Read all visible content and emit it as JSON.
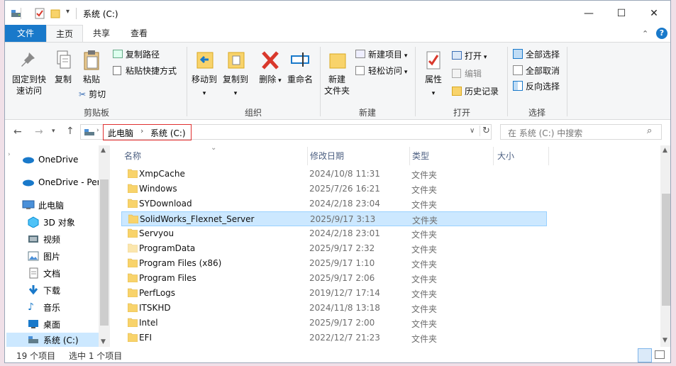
{
  "window": {
    "title": "系统 (C:)"
  },
  "ribbon_tabs": [
    "文件",
    "主页",
    "共享",
    "查看"
  ],
  "clipboard": {
    "pin_label": "固定到快\n速访问",
    "copy_label": "复制",
    "paste_label": "粘贴",
    "copy_path": "复制路径",
    "paste_shortcut": "粘贴快捷方式",
    "cut": "剪切",
    "group": "剪贴板"
  },
  "organize": {
    "move_to": "移动到",
    "copy_to": "复制到",
    "delete": "删除",
    "rename": "重命名",
    "group": "组织"
  },
  "new": {
    "new_folder": "新建\n文件夹",
    "new_item": "新建项目",
    "easy_access": "轻松访问",
    "group": "新建"
  },
  "open": {
    "properties": "属性",
    "open": "打开",
    "edit": "编辑",
    "history": "历史记录",
    "group": "打开"
  },
  "select": {
    "select_all": "全部选择",
    "select_none": "全部取消",
    "invert": "反向选择",
    "group": "选择"
  },
  "address": {
    "crumbs": [
      "此电脑",
      "系统 (C:)"
    ],
    "search_placeholder": "在 系统 (C:) 中搜索"
  },
  "nav": {
    "items": [
      {
        "label": "OneDrive",
        "icon": "cloud-icon"
      },
      {
        "label": "OneDrive - Per",
        "icon": "cloud-icon"
      },
      {
        "label": "此电脑",
        "icon": "pc-icon"
      },
      {
        "label": "3D 对象",
        "icon": "cube-icon"
      },
      {
        "label": "视频",
        "icon": "video-icon"
      },
      {
        "label": "图片",
        "icon": "picture-icon"
      },
      {
        "label": "文档",
        "icon": "document-icon"
      },
      {
        "label": "下载",
        "icon": "download-icon"
      },
      {
        "label": "音乐",
        "icon": "music-icon"
      },
      {
        "label": "桌面",
        "icon": "desktop-icon"
      },
      {
        "label": "系统 (C:)",
        "icon": "drive-icon"
      }
    ]
  },
  "columns": [
    "名称",
    "修改日期",
    "类型",
    "大小"
  ],
  "files": [
    {
      "name": "XmpCache",
      "date": "2024/10/8 11:31",
      "type": "文件夹"
    },
    {
      "name": "Windows",
      "date": "2025/7/26 16:21",
      "type": "文件夹"
    },
    {
      "name": "SYDownload",
      "date": "2024/2/18 23:04",
      "type": "文件夹"
    },
    {
      "name": "SolidWorks_Flexnet_Server",
      "date": "2025/9/17 3:13",
      "type": "文件夹"
    },
    {
      "name": "Servyou",
      "date": "2024/2/18 23:01",
      "type": "文件夹"
    },
    {
      "name": "ProgramData",
      "date": "2025/9/17 2:32",
      "type": "文件夹"
    },
    {
      "name": "Program Files (x86)",
      "date": "2025/9/17 1:10",
      "type": "文件夹"
    },
    {
      "name": "Program Files",
      "date": "2025/9/17 2:06",
      "type": "文件夹"
    },
    {
      "name": "PerfLogs",
      "date": "2019/12/7 17:14",
      "type": "文件夹"
    },
    {
      "name": "ITSKHD",
      "date": "2024/11/8 13:18",
      "type": "文件夹"
    },
    {
      "name": "Intel",
      "date": "2025/9/17 2:00",
      "type": "文件夹"
    },
    {
      "name": "EFI",
      "date": "2022/12/7 21:23",
      "type": "文件夹"
    }
  ],
  "selected_index": 3,
  "status": {
    "count": "19 个项目",
    "selected": "选中 1 个项目"
  }
}
